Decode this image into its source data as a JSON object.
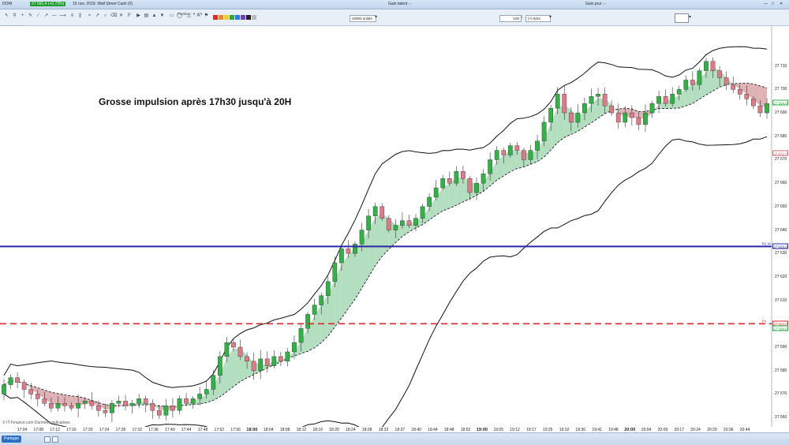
{
  "window": {
    "app_label": "DOW",
    "price_badge": "27 691,4 (+0,73%)",
    "instrument": "15 nov. 2019: Wall Street Cash (€)",
    "gain_latent": "Gain latent : -",
    "gain_jour": "Gain jour : -"
  },
  "toolbar": {
    "position_label": "Position : 0 - / 0",
    "quantity_value": "10000 unités",
    "ticks_value": "100",
    "ticks_unit": "(×) ticks",
    "indicator_tab": "Helion Assis"
  },
  "annotation": {
    "text": "Grosse impulsion après 17h30 jusqu'à 20H"
  },
  "footer": {
    "copyright": "© IT-Finance.com Données indicatives",
    "share_label": "Partager"
  },
  "colors": {
    "bull": "#2fb344",
    "bear": "#e07a86",
    "hline_blue": "#2a2aa8",
    "hline_red": "#e0262a",
    "band_green": "#a6d8b4",
    "band_red": "#d9a6a8"
  },
  "axis": {
    "x_ticks": [
      {
        "label": "17:04",
        "bold": false
      },
      {
        "label": "17:08",
        "bold": false
      },
      {
        "label": "17:12",
        "bold": false
      },
      {
        "label": "17:16",
        "bold": false
      },
      {
        "label": "17:20",
        "bold": false
      },
      {
        "label": "17:24",
        "bold": false
      },
      {
        "label": "17:28",
        "bold": false
      },
      {
        "label": "17:32",
        "bold": false
      },
      {
        "label": "17:36",
        "bold": false
      },
      {
        "label": "17:40",
        "bold": false
      },
      {
        "label": "17:44",
        "bold": false
      },
      {
        "label": "17:48",
        "bold": false
      },
      {
        "label": "17:52",
        "bold": false
      },
      {
        "label": "17:56",
        "bold": false
      },
      {
        "label": "18:00",
        "bold": true
      },
      {
        "label": "18:04",
        "bold": false
      },
      {
        "label": "18:08",
        "bold": false
      },
      {
        "label": "18:12",
        "bold": false
      },
      {
        "label": "18:16",
        "bold": false
      },
      {
        "label": "18:20",
        "bold": false
      },
      {
        "label": "18:24",
        "bold": false
      },
      {
        "label": "18:28",
        "bold": false
      },
      {
        "label": "18:32",
        "bold": false
      },
      {
        "label": "18:37",
        "bold": false
      },
      {
        "label": "18:40",
        "bold": false
      },
      {
        "label": "18:44",
        "bold": false
      },
      {
        "label": "18:48",
        "bold": false
      },
      {
        "label": "18:52",
        "bold": false
      },
      {
        "label": "19:00",
        "bold": true
      },
      {
        "label": "19:05",
        "bold": false
      },
      {
        "label": "19:12",
        "bold": false
      },
      {
        "label": "19:17",
        "bold": false
      },
      {
        "label": "19:25",
        "bold": false
      },
      {
        "label": "19:32",
        "bold": false
      },
      {
        "label": "19:36",
        "bold": false
      },
      {
        "label": "19:41",
        "bold": false
      },
      {
        "label": "19:48",
        "bold": false
      },
      {
        "label": "20:00",
        "bold": true
      },
      {
        "label": "20:04",
        "bold": false
      },
      {
        "label": "20:09",
        "bold": false
      },
      {
        "label": "20:17",
        "bold": false
      },
      {
        "label": "20:24",
        "bold": false
      },
      {
        "label": "20:29",
        "bold": false
      },
      {
        "label": "20:36",
        "bold": false
      },
      {
        "label": "20:44",
        "bold": false
      }
    ],
    "y_ticks": [
      "27 710",
      "27 700",
      "27 690",
      "27 680",
      "27 670",
      "27 660",
      "27 650",
      "27 640",
      "27 630",
      "27 620",
      "27 610",
      "27 600",
      "27 590",
      "27 580",
      "27 570",
      "27 560"
    ],
    "price_tags": [
      {
        "label": "27 694,4",
        "price": 27694.4,
        "color": "#2fb344"
      },
      {
        "label": "27 672,7",
        "price": 27672.7,
        "color": "#d46a74"
      },
      {
        "label": "27 633,0",
        "price": 27633.0,
        "color": "#2a2aa8"
      },
      {
        "label": "27 600,0",
        "price": 27600.0,
        "color": "#e0262a"
      },
      {
        "label": "27 598,0",
        "price": 27598.0,
        "color": "#2fb344"
      }
    ],
    "line_tags": {
      "blue": "R1 M",
      "red": "Pv"
    }
  },
  "chart_data": {
    "type": "candlestick",
    "ylim": [
      27556,
      27721
    ],
    "hlines": [
      {
        "value": 27633.0,
        "style": "solid"
      },
      {
        "value": 27600.0,
        "style": "dashed"
      }
    ],
    "points": [
      [
        27570,
        27574
      ],
      [
        27574,
        27577
      ],
      [
        27577,
        27575
      ],
      [
        27575,
        27572
      ],
      [
        27572,
        27570
      ],
      [
        27570,
        27568
      ],
      [
        27568,
        27566
      ],
      [
        27566,
        27564
      ],
      [
        27564,
        27566
      ],
      [
        27566,
        27565
      ],
      [
        27565,
        27564
      ],
      [
        27564,
        27566
      ],
      [
        27566,
        27567
      ],
      [
        27567,
        27565
      ],
      [
        27565,
        27563
      ],
      [
        27563,
        27562
      ],
      [
        27562,
        27566
      ],
      [
        27566,
        27567
      ],
      [
        27567,
        27565
      ],
      [
        27565,
        27566
      ],
      [
        27566,
        27568
      ],
      [
        27568,
        27566
      ],
      [
        27566,
        27563
      ],
      [
        27563,
        27561
      ],
      [
        27561,
        27565
      ],
      [
        27565,
        27563
      ],
      [
        27563,
        27568
      ],
      [
        27568,
        27566
      ],
      [
        27566,
        27568
      ],
      [
        27568,
        27570
      ],
      [
        27570,
        27572
      ],
      [
        27572,
        27578
      ],
      [
        27578,
        27586
      ],
      [
        27586,
        27592
      ],
      [
        27592,
        27590
      ],
      [
        27590,
        27586
      ],
      [
        27586,
        27584
      ],
      [
        27584,
        27580
      ],
      [
        27580,
        27585
      ],
      [
        27585,
        27582
      ],
      [
        27582,
        27586
      ],
      [
        27586,
        27584
      ],
      [
        27584,
        27588
      ],
      [
        27588,
        27592
      ],
      [
        27592,
        27598
      ],
      [
        27598,
        27604
      ],
      [
        27604,
        27608
      ],
      [
        27608,
        27612
      ],
      [
        27612,
        27618
      ],
      [
        27618,
        27626
      ],
      [
        27626,
        27632
      ],
      [
        27632,
        27630
      ],
      [
        27630,
        27634
      ],
      [
        27634,
        27640
      ],
      [
        27640,
        27646
      ],
      [
        27646,
        27650
      ],
      [
        27650,
        27645
      ],
      [
        27645,
        27640
      ],
      [
        27640,
        27642
      ],
      [
        27642,
        27644
      ],
      [
        27644,
        27642
      ],
      [
        27642,
        27645
      ],
      [
        27645,
        27650
      ],
      [
        27650,
        27654
      ],
      [
        27654,
        27658
      ],
      [
        27658,
        27662
      ],
      [
        27662,
        27660
      ],
      [
        27660,
        27665
      ],
      [
        27665,
        27662
      ],
      [
        27662,
        27656
      ],
      [
        27656,
        27660
      ],
      [
        27660,
        27664
      ],
      [
        27664,
        27670
      ],
      [
        27670,
        27674
      ],
      [
        27674,
        27672
      ],
      [
        27672,
        27676
      ],
      [
        27676,
        27674
      ],
      [
        27674,
        27670
      ],
      [
        27670,
        27674
      ],
      [
        27674,
        27678
      ],
      [
        27678,
        27686
      ],
      [
        27686,
        27692
      ],
      [
        27692,
        27698
      ],
      [
        27698,
        27690
      ],
      [
        27690,
        27686
      ],
      [
        27686,
        27690
      ],
      [
        27690,
        27694
      ],
      [
        27694,
        27697
      ],
      [
        27697,
        27698
      ],
      [
        27698,
        27693
      ],
      [
        27693,
        27690
      ],
      [
        27690,
        27686
      ],
      [
        27686,
        27690
      ],
      [
        27690,
        27688
      ],
      [
        27688,
        27685
      ],
      [
        27685,
        27690
      ],
      [
        27690,
        27694
      ],
      [
        27694,
        27697
      ],
      [
        27697,
        27694
      ],
      [
        27694,
        27698
      ],
      [
        27698,
        27700
      ],
      [
        27700,
        27704
      ],
      [
        27704,
        27702
      ],
      [
        27702,
        27708
      ],
      [
        27708,
        27712
      ],
      [
        27712,
        27708
      ],
      [
        27708,
        27705
      ],
      [
        27705,
        27702
      ],
      [
        27702,
        27700
      ],
      [
        27700,
        27698
      ],
      [
        27698,
        27696
      ],
      [
        27696,
        27693
      ],
      [
        27693,
        27690
      ],
      [
        27690,
        27694
      ]
    ]
  }
}
